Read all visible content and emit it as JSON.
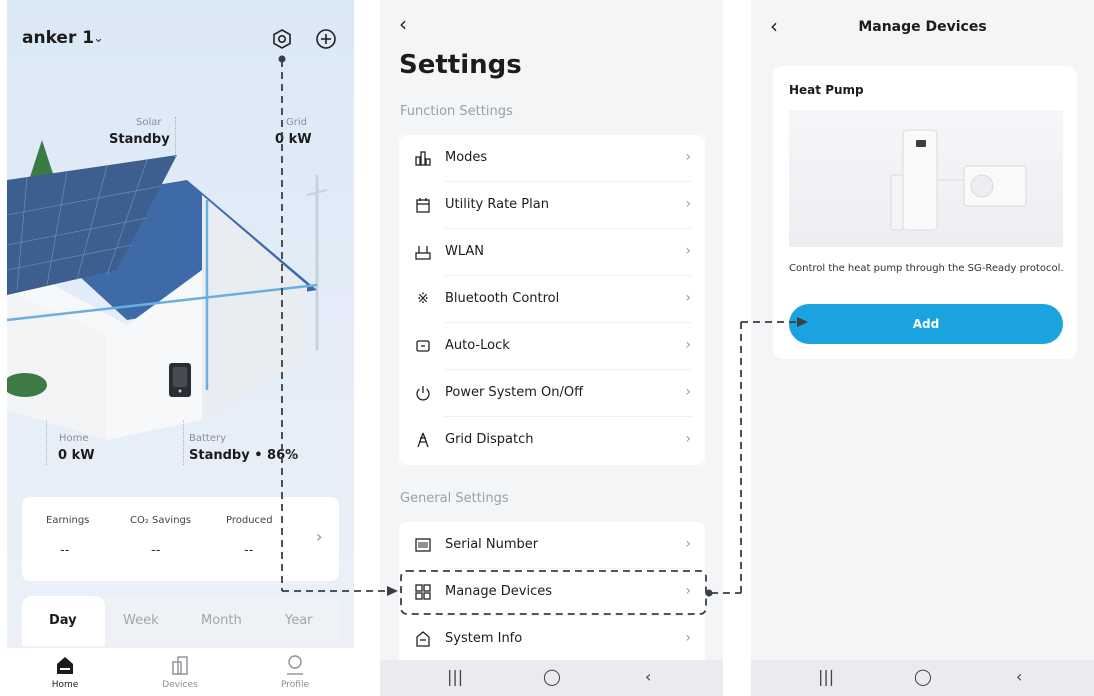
{
  "home": {
    "site_name": "anker 1",
    "solar": {
      "label": "Solar",
      "value": "Standby"
    },
    "grid": {
      "label": "Grid",
      "value": "0 kW"
    },
    "home_stat": {
      "label": "Home",
      "value": "0 kW"
    },
    "battery": {
      "label": "Battery",
      "value": "Standby • 86%"
    },
    "stats": {
      "earnings": {
        "label": "Earnings",
        "value": "--"
      },
      "co2": {
        "label": "CO₂ Savings",
        "value": "--"
      },
      "produced": {
        "label": "Produced",
        "value": "--"
      }
    },
    "periods": [
      "Day",
      "Week",
      "Month",
      "Year"
    ],
    "nav": [
      {
        "label": "Home",
        "icon": "home-icon"
      },
      {
        "label": "Devices",
        "icon": "devices-icon"
      },
      {
        "label": "Profile",
        "icon": "profile-icon"
      }
    ],
    "colors": {
      "accent": "#1aa3df",
      "sky": "#dbe8f6"
    }
  },
  "settings": {
    "title": "Settings",
    "function_section": "Function Settings",
    "function_items": [
      {
        "label": "Modes",
        "icon": "modes-icon"
      },
      {
        "label": "Utility Rate Plan",
        "icon": "calendar-icon"
      },
      {
        "label": "WLAN",
        "icon": "wlan-icon"
      },
      {
        "label": "Bluetooth Control",
        "icon": "bluetooth-icon"
      },
      {
        "label": "Auto-Lock",
        "icon": "lock-screen-icon"
      },
      {
        "label": "Power System On/Off",
        "icon": "power-icon"
      },
      {
        "label": "Grid Dispatch",
        "icon": "grid-tower-icon"
      }
    ],
    "general_section": "General Settings",
    "general_items": [
      {
        "label": "Serial Number",
        "icon": "barcode-icon"
      },
      {
        "label": "Manage Devices",
        "icon": "grid-apps-icon"
      },
      {
        "label": "System Info",
        "icon": "house-info-icon"
      }
    ]
  },
  "manage": {
    "title": "Manage Devices",
    "device_title": "Heat Pump",
    "description": "Control the heat pump through the SG-Ready protocol.",
    "add_label": "Add"
  }
}
